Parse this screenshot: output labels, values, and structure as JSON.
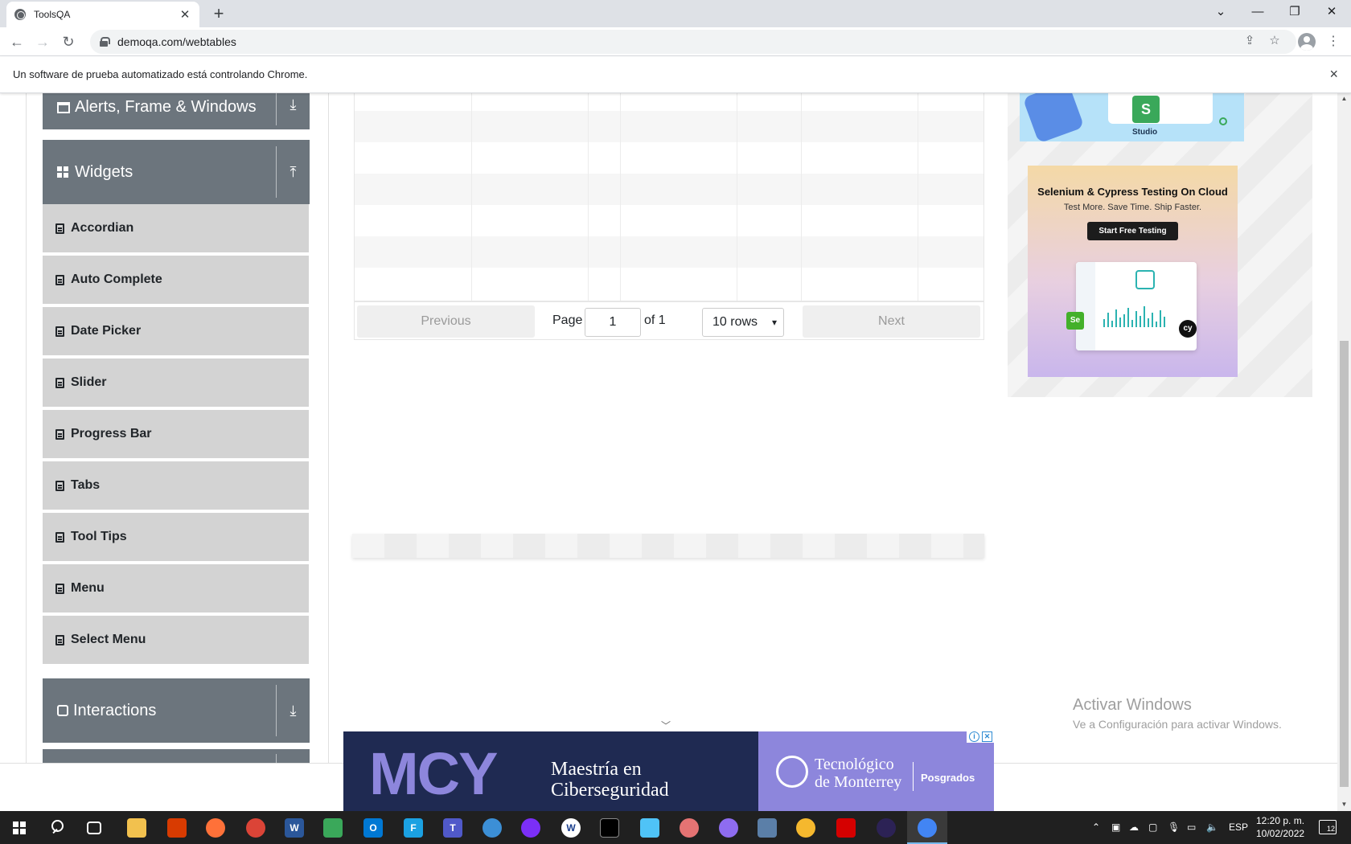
{
  "browser": {
    "tab_title": "ToolsQA",
    "new_tab": "+",
    "url": "demoqa.com/webtables",
    "infobar_text": "Un software de prueba automatizado está controlando Chrome.",
    "infobar_close": "×"
  },
  "sidebar": {
    "alerts_label": "Alerts, Frame & Windows",
    "widgets_label": "Widgets",
    "interactions_label": "Interactions",
    "widget_items": [
      "Accordian",
      "Auto Complete",
      "Date Picker",
      "Slider",
      "Progress Bar",
      "Tabs",
      "Tool Tips",
      "Menu",
      "Select Menu"
    ]
  },
  "table": {
    "previous_label": "Previous",
    "page_label": "Page",
    "page_value": "1",
    "of_label": "of 1",
    "rows_select": "10 rows",
    "next_label": "Next"
  },
  "ads": {
    "robot_logo": "S",
    "robot_caption": "Studio",
    "selenium_title": "Selenium & Cypress Testing On Cloud",
    "selenium_sub": "Test More. Save Time. Ship Faster.",
    "selenium_cta": "Start Free Testing",
    "selenium_badge_se": "Se",
    "selenium_badge_cy": "cy",
    "mcy_big": "MCY",
    "mcy_line1": "Maestría en",
    "mcy_line2": "Ciberseguridad",
    "tec_line1": "Tecnológico",
    "tec_line2": "de Monterrey",
    "posgrados": "Posgrados"
  },
  "windows": {
    "activate_title": "Activar Windows",
    "activate_sub": "Ve a Configuración para activar Windows.",
    "lang": "ESP",
    "time": "12:20 p. m.",
    "date": "10/02/2022",
    "notifications": "12"
  }
}
